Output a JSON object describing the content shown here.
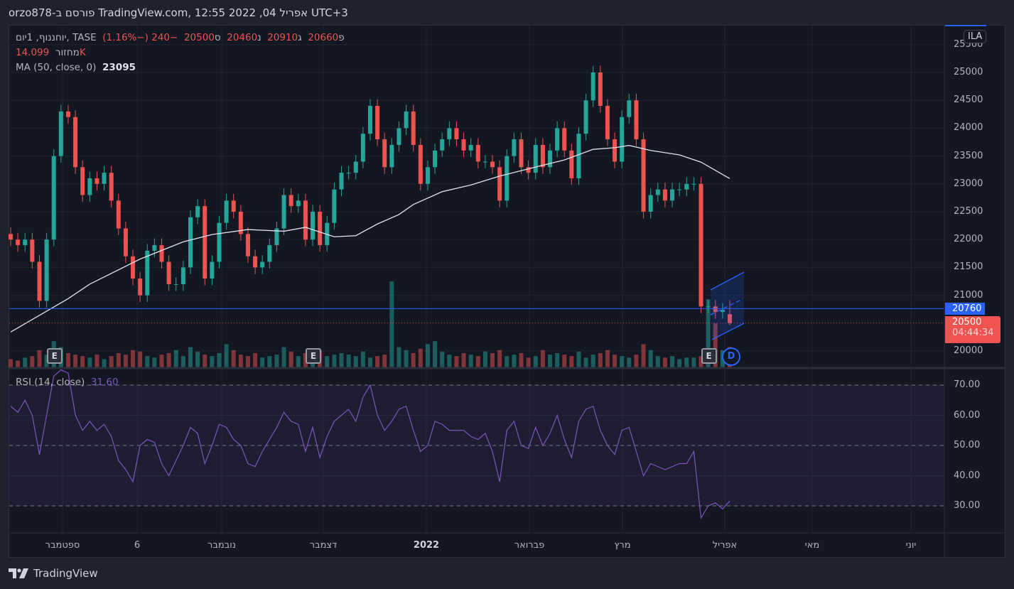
{
  "title": "orzo878-פורסם ב TradingView.com, 12:55 2022 ,04 אפריל UTC+3",
  "legend": {
    "symbol": "יוחננוף, 1יום, TASE",
    "open_label": "פ",
    "open": "20660",
    "high_label": "ג",
    "high": "20910",
    "low_label": "נ",
    "low": "20460",
    "close_label": "ס",
    "close": "20500",
    "change": "−240 (−1.16%)",
    "volume_label": "מחזור",
    "volume": "14.099K",
    "ma_label": "MA (50, close, 0)",
    "ma_value": "23095",
    "rsi_label": "RSI (14, close)",
    "rsi_value": "31.60"
  },
  "currency_badge": "ILA",
  "price_tags": {
    "line": "20760",
    "last": "20500",
    "countdown": "04:44:34"
  },
  "markers": {
    "earnings": "E",
    "dividend": "D"
  },
  "footer": {
    "brand": "TradingView"
  },
  "colors": {
    "up": "#26a69a",
    "down": "#ef5350",
    "ma": "#e0e3eb",
    "rsi": "#7e57c2",
    "price_line": "#2962ff",
    "background": "#131722"
  },
  "chart_data": [
    {
      "type": "candlestick",
      "title": "",
      "ylim": [
        19700,
        25600
      ],
      "yticks": [
        "20000",
        "21000",
        "21500",
        "22000",
        "22500",
        "23000",
        "23500",
        "24000",
        "24500",
        "25000",
        "25500"
      ],
      "xticks": [
        "ספטמבר",
        "6",
        "נובמבר",
        "דצמבר",
        "2022",
        "פברואר",
        "מרץ",
        "אפריל",
        "מאי",
        "יוני"
      ],
      "grid": true,
      "last_candle": {
        "open": 20660,
        "high": 20910,
        "low": 20460,
        "close": 20500
      },
      "close": [
        22000,
        21900,
        22000,
        21600,
        20900,
        22000,
        23500,
        24300,
        24200,
        23300,
        22800,
        23100,
        23000,
        23200,
        22700,
        22200,
        21700,
        21300,
        21000,
        21800,
        21900,
        21600,
        21200,
        21200,
        21500,
        22400,
        22600,
        21300,
        21600,
        22300,
        22700,
        22500,
        22100,
        21700,
        21500,
        21600,
        21900,
        22200,
        22800,
        22600,
        22700,
        22000,
        22500,
        21900,
        22300,
        22900,
        23200,
        23200,
        23400,
        23900,
        24400,
        23800,
        23300,
        23700,
        24000,
        24300,
        23700,
        23000,
        23300,
        23600,
        23800,
        24000,
        23800,
        23600,
        23700,
        23400,
        23400,
        23300,
        22700,
        23500,
        23800,
        23300,
        23200,
        23700,
        23300,
        23600,
        24000,
        23600,
        23100,
        23900,
        24500,
        25000,
        24400,
        23800,
        23400,
        24200,
        24500,
        23800,
        22500,
        22800,
        22900,
        22700,
        22900,
        22900,
        23000,
        23000,
        20800,
        20800,
        20700,
        20740,
        20500
      ],
      "volume_k": [
        6,
        5,
        7,
        8,
        12,
        9,
        18,
        14,
        10,
        9,
        8,
        7,
        9,
        6,
        8,
        10,
        9,
        12,
        11,
        8,
        7,
        9,
        10,
        12,
        8,
        14,
        11,
        9,
        8,
        10,
        16,
        12,
        9,
        8,
        10,
        7,
        8,
        9,
        14,
        11,
        8,
        10,
        9,
        12,
        8,
        9,
        10,
        9,
        8,
        11,
        7,
        8,
        9,
        58,
        14,
        12,
        10,
        13,
        16,
        18,
        11,
        9,
        8,
        10,
        9,
        8,
        11,
        10,
        12,
        8,
        9,
        10,
        7,
        8,
        12,
        9,
        10,
        9,
        8,
        11,
        7,
        9,
        10,
        12,
        9,
        8,
        7,
        9,
        16,
        12,
        8,
        7,
        8,
        6,
        7,
        7,
        8,
        46,
        30,
        12,
        14.099
      ],
      "ma": {
        "period": 50,
        "points": [
          [
            0,
            20340
          ],
          [
            8,
            20940
          ],
          [
            11,
            21200
          ],
          [
            18,
            21650
          ],
          [
            24,
            21960
          ],
          [
            28,
            22090
          ],
          [
            33,
            22180
          ],
          [
            38,
            22150
          ],
          [
            41,
            22220
          ],
          [
            45,
            22050
          ],
          [
            48,
            22070
          ],
          [
            51,
            22280
          ],
          [
            54,
            22450
          ],
          [
            56,
            22630
          ],
          [
            60,
            22860
          ],
          [
            64,
            22980
          ],
          [
            68,
            23140
          ],
          [
            72,
            23270
          ],
          [
            77,
            23430
          ],
          [
            81,
            23620
          ],
          [
            84,
            23650
          ],
          [
            86,
            23690
          ],
          [
            89,
            23600
          ],
          [
            93,
            23520
          ],
          [
            96,
            23390
          ],
          [
            100,
            23095
          ]
        ]
      },
      "price_line": 20760,
      "earnings_at": [
        6,
        42,
        97
      ],
      "dividend_at": [
        100
      ]
    },
    {
      "type": "line",
      "title": "RSI (14, close)",
      "ylim": [
        21,
        75
      ],
      "yticks": [
        "30.00",
        "40.00",
        "50.00",
        "60.00",
        "70.00"
      ],
      "bands": [
        30,
        50,
        70
      ],
      "values": [
        63,
        61,
        65,
        60,
        47,
        60,
        73,
        75,
        74,
        60,
        55,
        58,
        55,
        57,
        53,
        45,
        42,
        38,
        50,
        52,
        51,
        44,
        40,
        45,
        50,
        56,
        54,
        44,
        50,
        57,
        56,
        52,
        50,
        44,
        43,
        48,
        52,
        56,
        61,
        58,
        57,
        48,
        56,
        46,
        53,
        58,
        60,
        62,
        58,
        66,
        70,
        60,
        55,
        58,
        62,
        63,
        55,
        48,
        50,
        58,
        57,
        55,
        55,
        55,
        53,
        52,
        54,
        48,
        38,
        55,
        58,
        50,
        49,
        56,
        50,
        54,
        60,
        52,
        46,
        58,
        62,
        63,
        55,
        50,
        47,
        55,
        56,
        48,
        40,
        44,
        43,
        42,
        43,
        44,
        44,
        48,
        26,
        30,
        31,
        29,
        31.6
      ]
    }
  ]
}
